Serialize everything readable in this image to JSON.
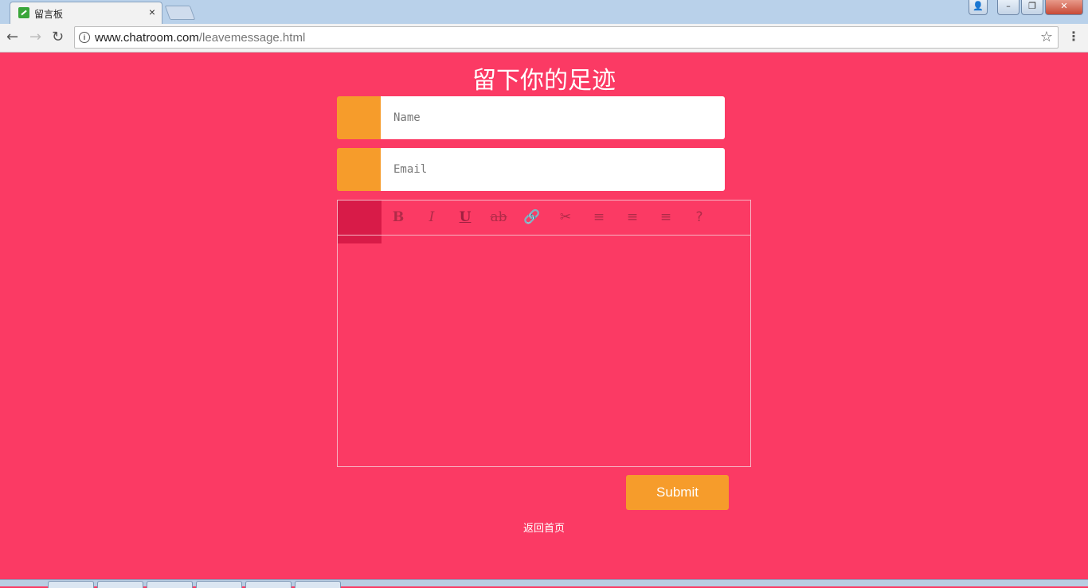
{
  "browser": {
    "tab_title": "留言板",
    "tab_close": "×",
    "url_host": "www.chatroom.com",
    "url_path": "/leavemessage.html",
    "back_icon": "←",
    "forward_icon": "→",
    "reload_icon": "↻",
    "info_icon": "i",
    "star_icon": "☆",
    "menu_icon": "⋮",
    "window_user": "👤",
    "window_min": "–",
    "window_max": "❐",
    "window_close": "✕"
  },
  "page": {
    "title": "留下你的足迹",
    "background_color": "#fb3a64",
    "accent_color": "#f69c2b"
  },
  "form": {
    "name_placeholder": "Name",
    "email_placeholder": "Email",
    "toolbar": {
      "bold": "B",
      "italic": "I",
      "underline": "U",
      "strike": "ab",
      "link": "🔗",
      "unlink": "✂",
      "align_left": "≡",
      "align_center": "≡",
      "align_right": "≡",
      "help": "?"
    },
    "submit_label": "Submit"
  },
  "footer": {
    "home_link": "返回首页"
  }
}
